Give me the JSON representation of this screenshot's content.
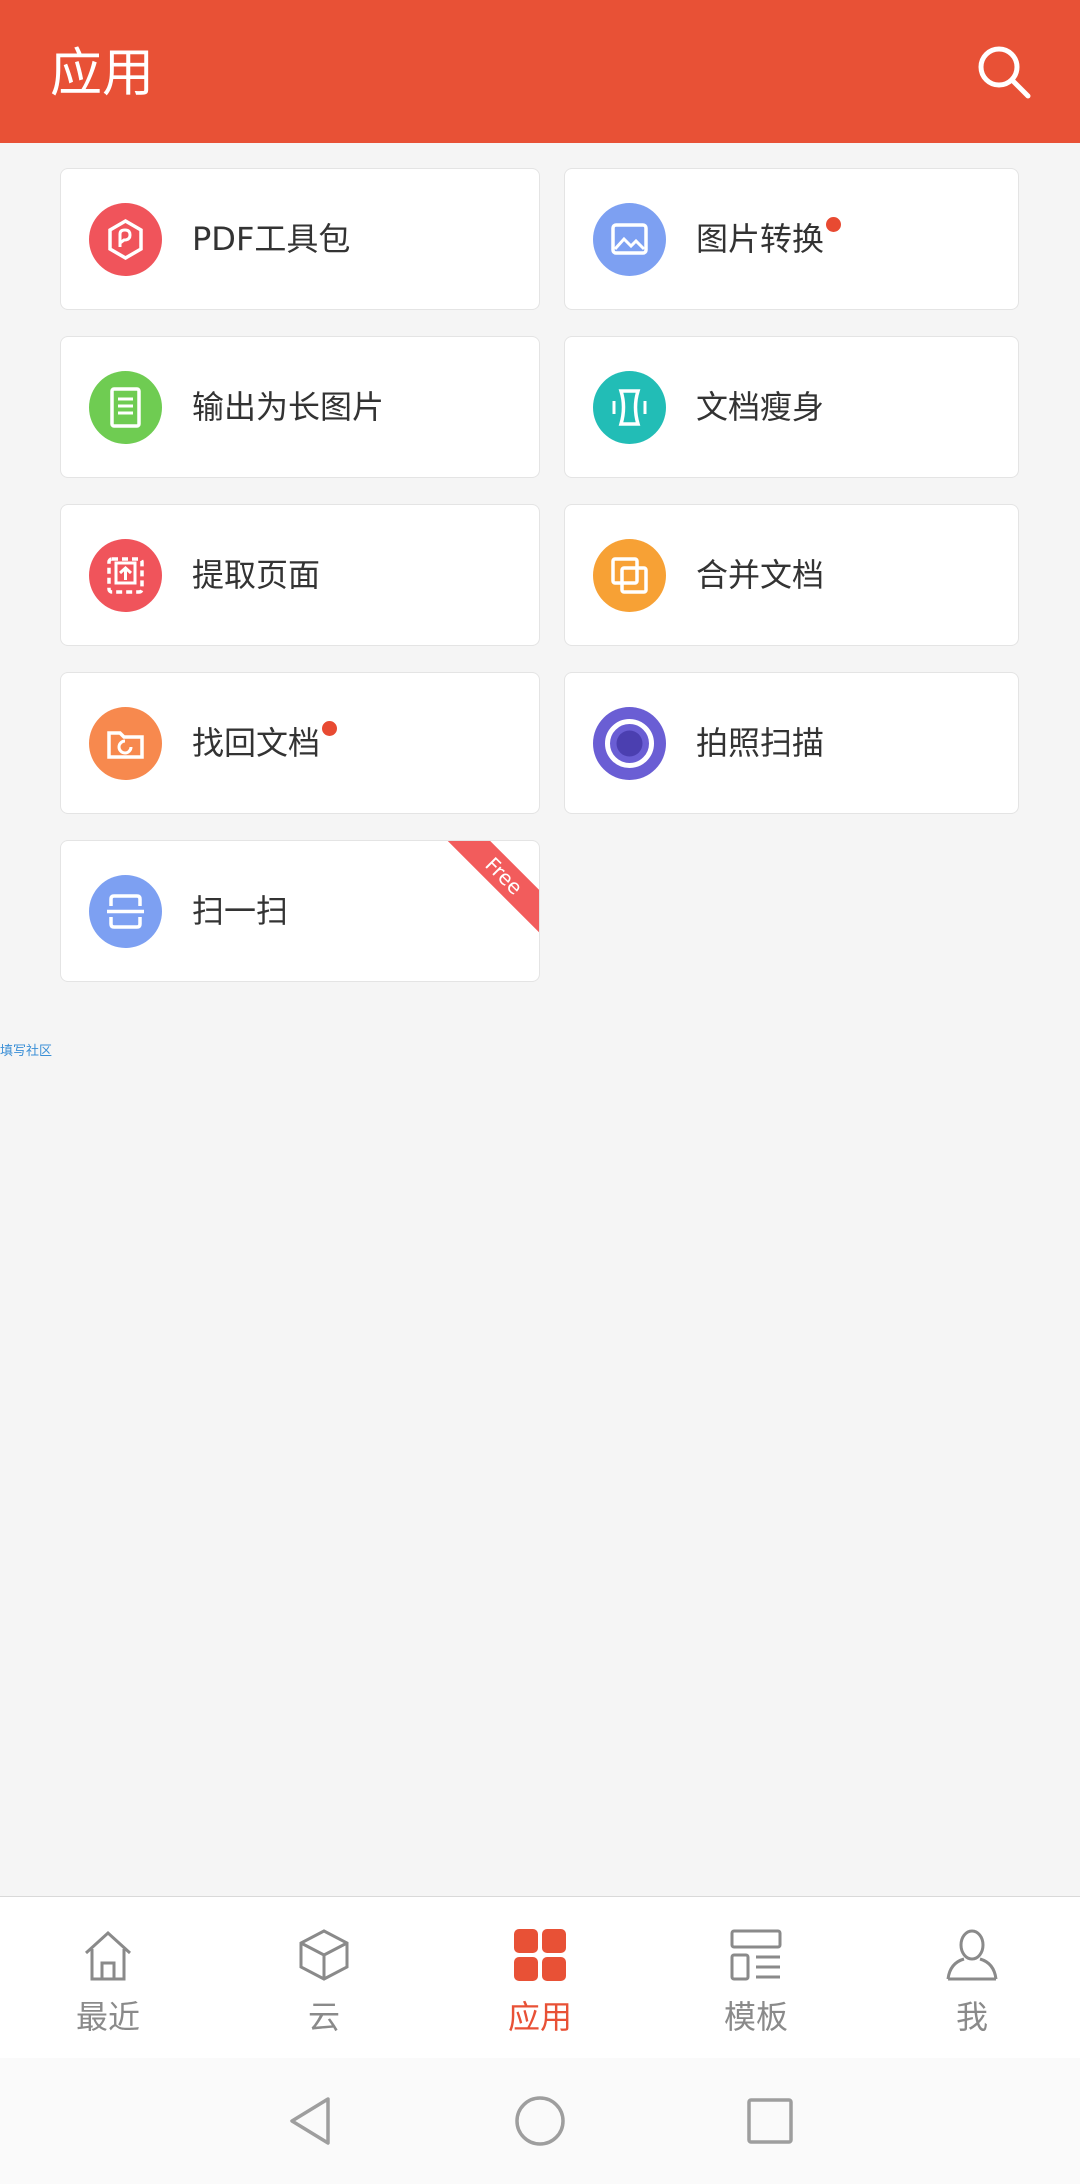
{
  "header": {
    "title": "应用",
    "search_icon": "search-icon"
  },
  "colors": {
    "brand": "#e85136",
    "badge_dot": "#e84a32",
    "free_ribbon": "#f25c5c"
  },
  "apps": [
    {
      "label": "PDF工具包",
      "icon": "pdf-toolkit-icon",
      "color": "#f0545b",
      "dot": false
    },
    {
      "label": "图片转换",
      "icon": "image-convert-icon",
      "color": "#7da0f2",
      "dot": true
    },
    {
      "label": "输出为长图片",
      "icon": "long-image-icon",
      "color": "#6fcc52",
      "dot": false
    },
    {
      "label": "文档瘦身",
      "icon": "slim-document-icon",
      "color": "#22bdb6",
      "dot": false
    },
    {
      "label": "提取页面",
      "icon": "extract-page-icon",
      "color": "#f0545b",
      "dot": false
    },
    {
      "label": "合并文档",
      "icon": "merge-document-icon",
      "color": "#f7a135",
      "dot": false
    },
    {
      "label": "找回文档",
      "icon": "recover-document-icon",
      "color": "#f7894e",
      "dot": true
    },
    {
      "label": "拍照扫描",
      "icon": "camera-scan-icon",
      "color": "#6a5ed4",
      "dot": false
    },
    {
      "label": "扫一扫",
      "icon": "scan-qr-icon",
      "color": "#7da0f2",
      "dot": false,
      "ribbon": "Free"
    }
  ],
  "community_link": "填写社区",
  "tabs": [
    {
      "label": "最近",
      "icon": "home-icon",
      "active": false
    },
    {
      "label": "云",
      "icon": "cloud-box-icon",
      "active": false
    },
    {
      "label": "应用",
      "icon": "apps-grid-icon",
      "active": true
    },
    {
      "label": "模板",
      "icon": "template-icon",
      "active": false
    },
    {
      "label": "我",
      "icon": "profile-icon",
      "active": false
    }
  ],
  "system_nav": [
    "back-icon",
    "home-circle-icon",
    "recents-icon"
  ]
}
